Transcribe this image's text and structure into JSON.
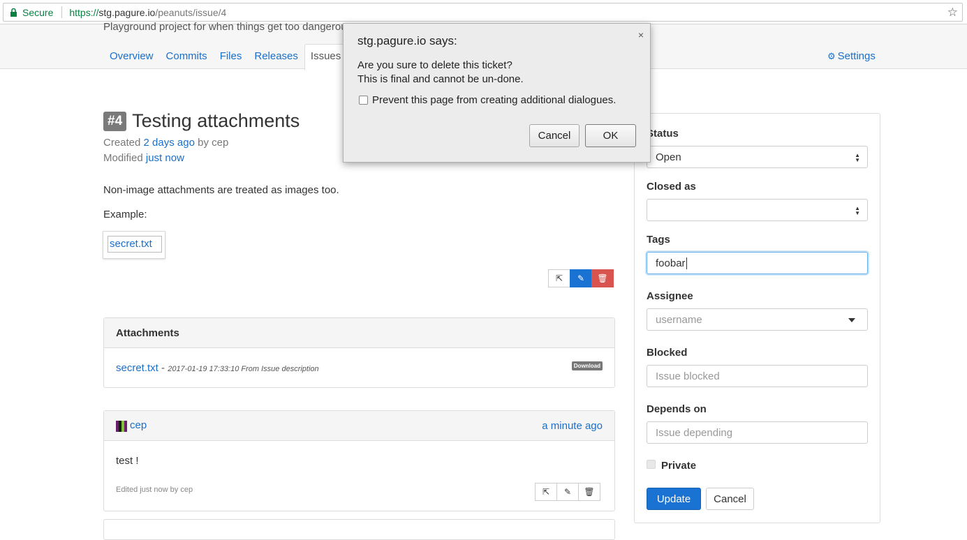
{
  "browser": {
    "secure_label": "Secure",
    "url_scheme": "https://",
    "url_host": "stg.pagure.io",
    "url_path": "/peanuts/issue/4"
  },
  "repo": {
    "description": "Playground project for when things get too dangerous",
    "tabs": [
      {
        "label": "Overview"
      },
      {
        "label": "Commits"
      },
      {
        "label": "Files"
      },
      {
        "label": "Releases"
      },
      {
        "label": "Issues"
      }
    ],
    "settings_label": "Settings"
  },
  "issue": {
    "number": "#4",
    "title": "Testing attachments",
    "created_prefix": "Created",
    "created_when": "2 days ago",
    "created_by_prefix": "by",
    "created_by": "cep",
    "modified_prefix": "Modified",
    "modified_when": "just now",
    "body_line1": "Non-image attachments are treated as images too.",
    "body_line2": "Example:",
    "image_alt": "secret.txt"
  },
  "attachments": {
    "title": "Attachments",
    "file_name": "secret.txt",
    "separator": " - ",
    "file_meta": "2017-01-19 17:33:10 From Issue description",
    "download_label": "Download"
  },
  "comment": {
    "author": "cep",
    "time": "a minute ago",
    "text": "test !",
    "edited": "Edited just now by cep"
  },
  "sidebar": {
    "status_label": "Status",
    "status_value": "Open",
    "closed_as_label": "Closed as",
    "closed_as_value": "",
    "tags_label": "Tags",
    "tags_value": "foobar",
    "assignee_label": "Assignee",
    "assignee_placeholder": "username",
    "blocked_label": "Blocked",
    "blocked_placeholder": "Issue blocked",
    "depends_label": "Depends on",
    "depends_placeholder": "Issue depending",
    "private_label": "Private",
    "update_label": "Update",
    "cancel_label": "Cancel"
  },
  "dialog": {
    "title": "stg.pagure.io says:",
    "close_glyph": "×",
    "message_line1": "Are you sure to delete this ticket?",
    "message_line2": "This is final and cannot be un-done.",
    "checkbox_label": "Prevent this page from creating additional dialogues.",
    "cancel_label": "Cancel",
    "ok_label": "OK"
  },
  "colors": {
    "link": "#1a6fc9",
    "primary": "#1a73d2",
    "danger": "#d9534f",
    "secure": "#0b8043"
  }
}
